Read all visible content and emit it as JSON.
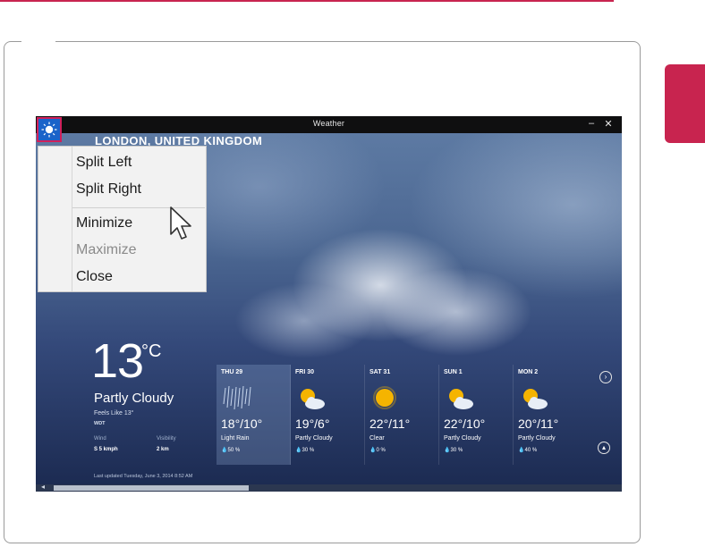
{
  "window": {
    "title": "Weather"
  },
  "location": {
    "city": "LONDON, UNITED KINGDOM"
  },
  "menu": {
    "items": [
      {
        "label": "Split Left",
        "enabled": true
      },
      {
        "label": "Split Right",
        "enabled": true
      },
      {
        "label": "Minimize",
        "enabled": true
      },
      {
        "label": "Maximize",
        "enabled": false
      },
      {
        "label": "Close",
        "enabled": true
      }
    ]
  },
  "current": {
    "temperature": "13",
    "unit": "°C",
    "condition": "Partly Cloudy",
    "feels_like": "Feels Like 13°",
    "station": "WDT",
    "wind_label": "Wind",
    "wind_value": "S 5 kmph",
    "visibility_label": "Visibility",
    "visibility_value": "2 km",
    "last_updated": "Last updated Tuesday, June 3, 2014 8:52 AM"
  },
  "forecast": [
    {
      "day": "THU 29",
      "temp": "18°/10°",
      "condition": "Light Rain",
      "precip": "50 %",
      "icon": "rain-icon"
    },
    {
      "day": "FRI 30",
      "temp": "19°/6°",
      "condition": "Partly Cloudy",
      "precip": "30 %",
      "icon": "partly-cloudy-icon"
    },
    {
      "day": "SAT 31",
      "temp": "22°/11°",
      "condition": "Clear",
      "precip": "0 %",
      "icon": "sun-icon"
    },
    {
      "day": "SUN 1",
      "temp": "22°/10°",
      "condition": "Partly Cloudy",
      "precip": "30 %",
      "icon": "partly-cloudy-icon"
    },
    {
      "day": "MON 2",
      "temp": "20°/11°",
      "condition": "Partly Cloudy",
      "precip": "40 %",
      "icon": "partly-cloudy-icon"
    }
  ],
  "icons": {
    "app": "sun-icon",
    "next": "arrow-right-circle-icon",
    "collapse": "arrow-up-circle-icon",
    "minimize": "minimize-icon",
    "close": "close-icon"
  },
  "colors": {
    "accent": "#c8244f",
    "app_icon_bg": "#1a63c9",
    "title_bar": "#0f0f10"
  }
}
